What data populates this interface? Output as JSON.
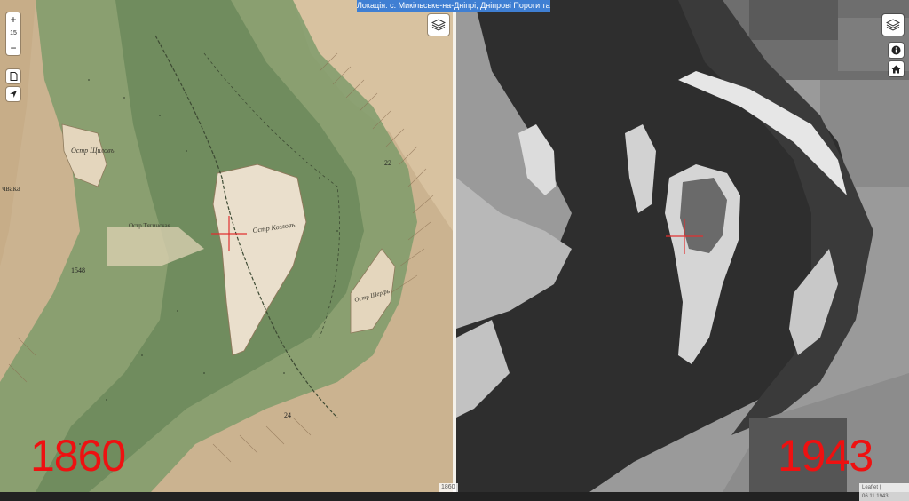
{
  "title": "Локація: с. Микільське-на-Дніпрі, Дніпрові Пороги та околиці",
  "zoom": {
    "in_label": "+",
    "level": "15",
    "out_label": "−"
  },
  "left_map": {
    "year": "1860",
    "corner_label": "1860",
    "year_color": "#ee1111",
    "map_labels": [
      "Остр Щиловъ",
      "Остр Козловъ",
      "Остр Тягинская",
      "Остр Шерфь",
      "1548",
      "22",
      "24",
      "чвака"
    ]
  },
  "right_map": {
    "year": "1943",
    "attribution": "Leaflet | 06.11.1943"
  },
  "icons": {
    "layers": "layers-icon",
    "info": "info-icon",
    "home": "home-icon",
    "document": "document-icon",
    "locate": "locate-arrow-icon",
    "crosshair": "crosshair-icon"
  }
}
